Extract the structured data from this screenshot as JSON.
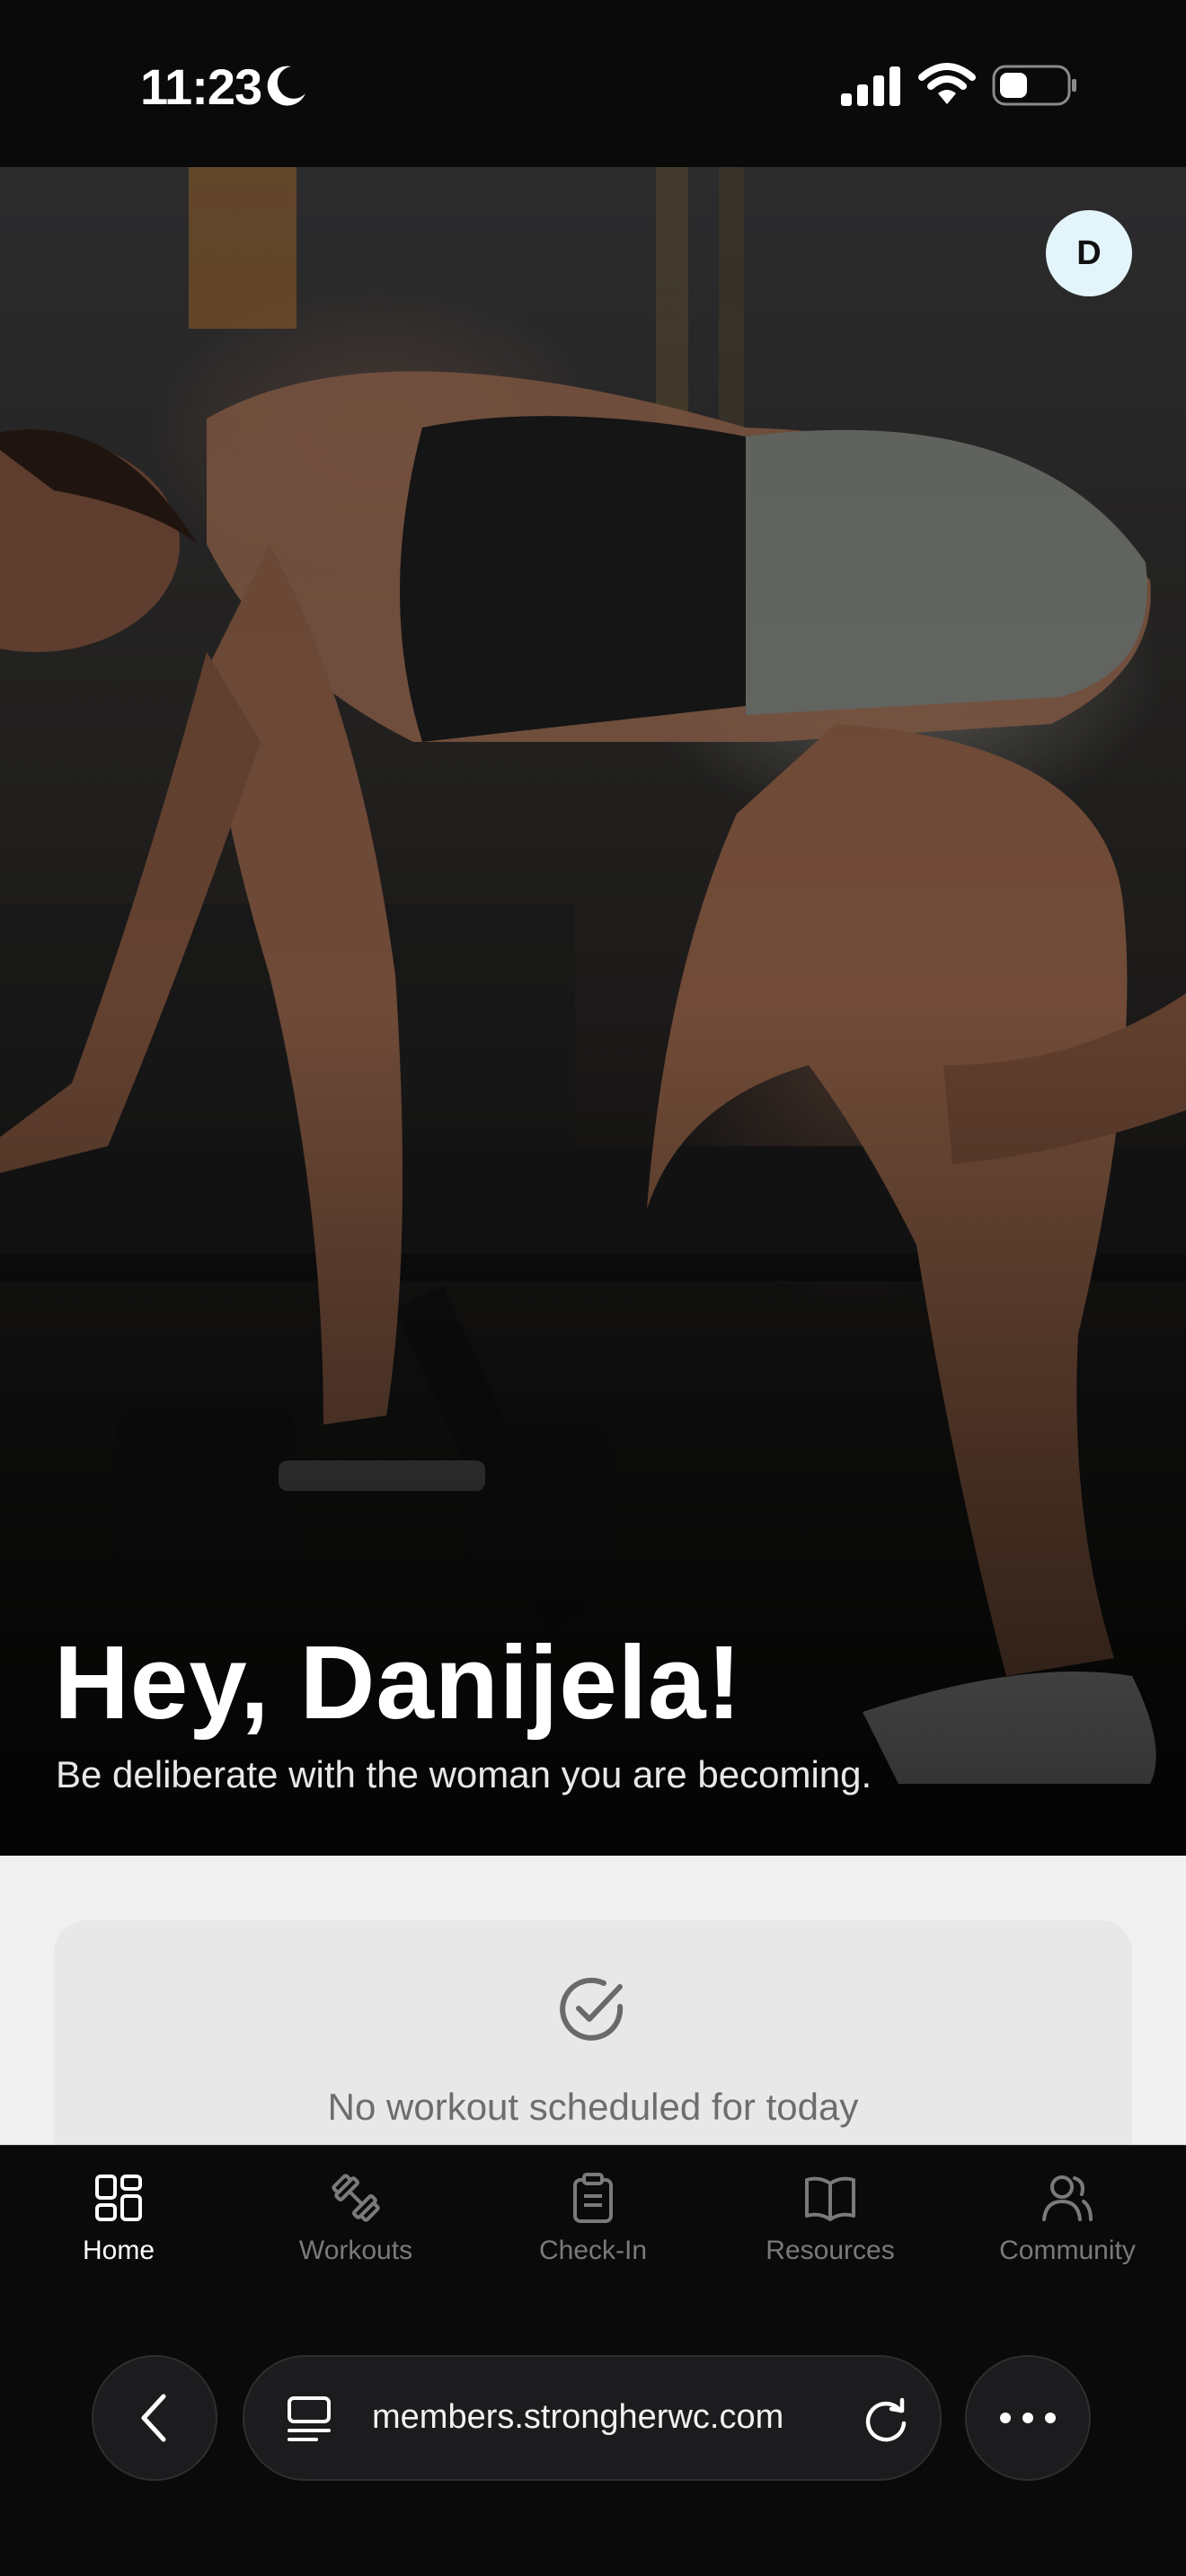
{
  "status_bar": {
    "time": "11:23",
    "icons": [
      "moon-icon",
      "cellular-signal-icon",
      "wifi-icon",
      "battery-icon"
    ]
  },
  "hero": {
    "avatar_initial": "D",
    "greeting": "Hey, Danijela!",
    "subtitle": "Be deliberate with the woman you are becoming."
  },
  "today_card": {
    "icon": "check-circle-icon",
    "message": "No workout scheduled for today"
  },
  "tab_bar": {
    "items": [
      {
        "label": "Home",
        "icon": "grid-icon",
        "active": true
      },
      {
        "label": "Workouts",
        "icon": "dumbbell-icon",
        "active": false
      },
      {
        "label": "Check-In",
        "icon": "clipboard-icon",
        "active": false
      },
      {
        "label": "Resources",
        "icon": "book-icon",
        "active": false
      },
      {
        "label": "Community",
        "icon": "users-icon",
        "active": false
      }
    ]
  },
  "browser": {
    "url": "members.strongherwc.com",
    "icons": [
      "back-icon",
      "tabs-icon",
      "reload-icon",
      "more-icon"
    ]
  },
  "colors": {
    "background": "#0a0a0a",
    "content_bg": "#f0f0f0",
    "card_bg": "#e8e8e8",
    "avatar_bg": "#e3f5fb",
    "tab_active": "#ffffff",
    "tab_inactive": "#7a7a7a"
  }
}
